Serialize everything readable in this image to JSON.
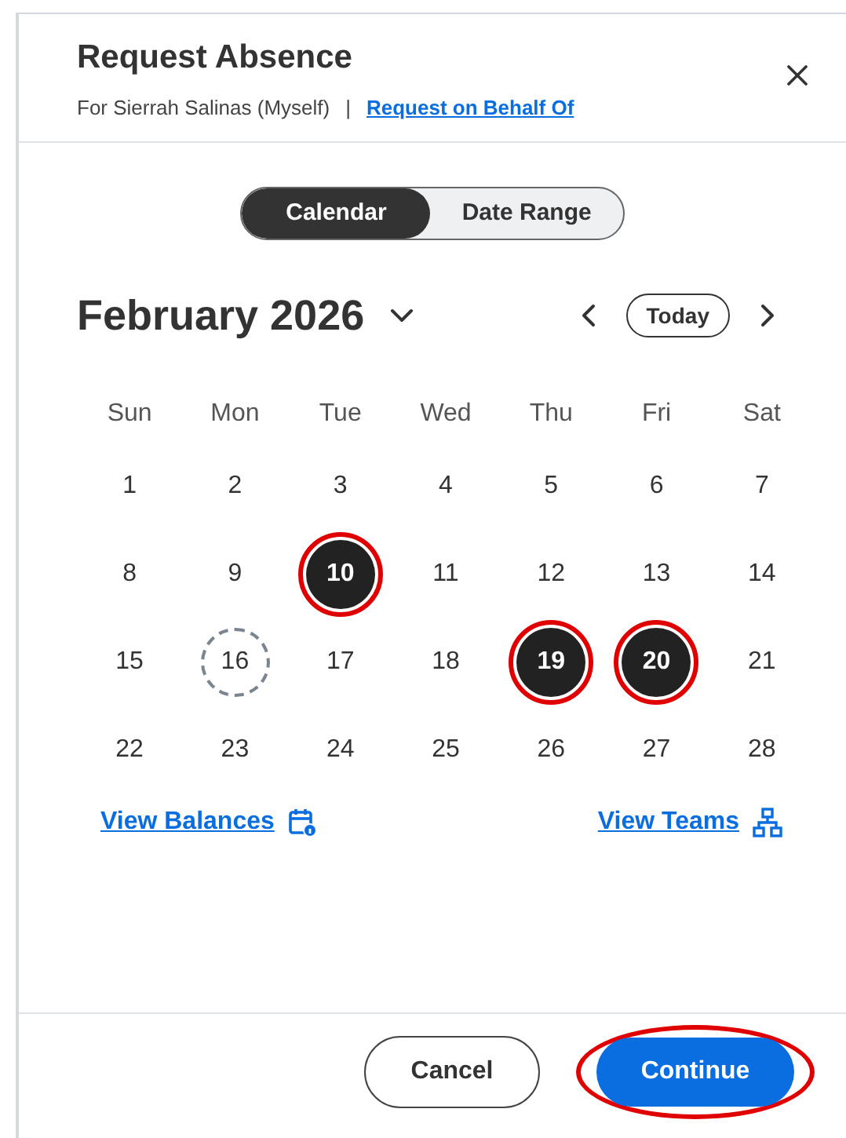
{
  "header": {
    "title": "Request Absence",
    "subtitle": "For Sierrah Salinas (Myself)",
    "separator": "|",
    "link": "Request on Behalf Of"
  },
  "view_toggle": [
    {
      "label": "Calendar",
      "selected": true
    },
    {
      "label": "Date Range",
      "selected": false
    }
  ],
  "calendar": {
    "month": "February 2026",
    "today_button": "Today",
    "weekdays": [
      "Sun",
      "Mon",
      "Tue",
      "Wed",
      "Thu",
      "Fri",
      "Sat"
    ],
    "days": [
      {
        "label": "1",
        "selected": false,
        "today": false,
        "highlighted": false
      },
      {
        "label": "2",
        "selected": false,
        "today": false,
        "highlighted": false
      },
      {
        "label": "3",
        "selected": false,
        "today": false,
        "highlighted": false
      },
      {
        "label": "4",
        "selected": false,
        "today": false,
        "highlighted": false
      },
      {
        "label": "5",
        "selected": false,
        "today": false,
        "highlighted": false
      },
      {
        "label": "6",
        "selected": false,
        "today": false,
        "highlighted": false
      },
      {
        "label": "7",
        "selected": false,
        "today": false,
        "highlighted": false
      },
      {
        "label": "8",
        "selected": false,
        "today": false,
        "highlighted": false
      },
      {
        "label": "9",
        "selected": false,
        "today": false,
        "highlighted": false
      },
      {
        "label": "10",
        "selected": true,
        "today": false,
        "highlighted": true
      },
      {
        "label": "11",
        "selected": false,
        "today": false,
        "highlighted": false
      },
      {
        "label": "12",
        "selected": false,
        "today": false,
        "highlighted": false
      },
      {
        "label": "13",
        "selected": false,
        "today": false,
        "highlighted": false
      },
      {
        "label": "14",
        "selected": false,
        "today": false,
        "highlighted": false
      },
      {
        "label": "15",
        "selected": false,
        "today": false,
        "highlighted": false
      },
      {
        "label": "16",
        "selected": false,
        "today": true,
        "highlighted": false
      },
      {
        "label": "17",
        "selected": false,
        "today": false,
        "highlighted": false
      },
      {
        "label": "18",
        "selected": false,
        "today": false,
        "highlighted": false
      },
      {
        "label": "19",
        "selected": true,
        "today": false,
        "highlighted": true
      },
      {
        "label": "20",
        "selected": true,
        "today": false,
        "highlighted": true
      },
      {
        "label": "21",
        "selected": false,
        "today": false,
        "highlighted": false
      },
      {
        "label": "22",
        "selected": false,
        "today": false,
        "highlighted": false
      },
      {
        "label": "23",
        "selected": false,
        "today": false,
        "highlighted": false
      },
      {
        "label": "24",
        "selected": false,
        "today": false,
        "highlighted": false
      },
      {
        "label": "25",
        "selected": false,
        "today": false,
        "highlighted": false
      },
      {
        "label": "26",
        "selected": false,
        "today": false,
        "highlighted": false
      },
      {
        "label": "27",
        "selected": false,
        "today": false,
        "highlighted": false
      },
      {
        "label": "28",
        "selected": false,
        "today": false,
        "highlighted": false
      }
    ]
  },
  "links": [
    {
      "label": "View Balances",
      "kind": "balances"
    },
    {
      "label": "View Teams",
      "kind": "teams"
    }
  ],
  "footer": {
    "buttons": [
      {
        "label": "Cancel",
        "kind": "secondary",
        "highlighted": false
      },
      {
        "label": "Continue",
        "kind": "primary",
        "highlighted": true
      }
    ]
  }
}
